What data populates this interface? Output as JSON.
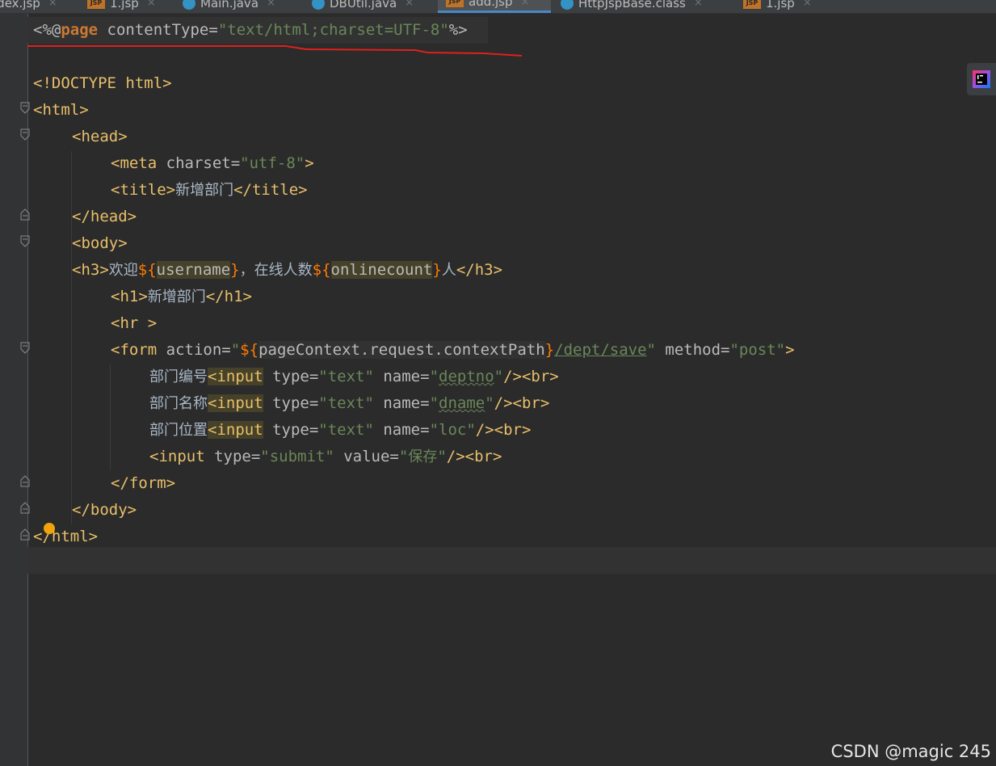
{
  "tabs": [
    {
      "label": "idex.jsp",
      "type": "jsp"
    },
    {
      "label": "1.jsp",
      "type": "jsp"
    },
    {
      "label": "Main.java",
      "type": "java"
    },
    {
      "label": "DBUtil.java",
      "type": "java"
    },
    {
      "label": "add.jsp",
      "type": "jsp",
      "active": true
    },
    {
      "label": "HttpJspBase.class",
      "type": "class"
    },
    {
      "label": "1.jsp",
      "type": "jsp"
    }
  ],
  "file_icon_text": "JSP",
  "close_glyph": "×",
  "badge_icon": "intellij-icon",
  "watermark": "CSDN @magic 245",
  "code": {
    "l1": {
      "open": "<%@",
      "kw": "page",
      "attr": " contentType=",
      "val": "\"text/html;charset=UTF-8\"",
      "close": "%>"
    },
    "l3": "<!DOCTYPE html>",
    "l4": "<html>",
    "l5": "<head>",
    "l6": {
      "tag_open": "<meta",
      "attr": " charset=",
      "val": "\"utf-8\"",
      "tag_close": ">"
    },
    "l7": {
      "open": "<title>",
      "text": "新增部门",
      "close": "</title>"
    },
    "l8": "</head>",
    "l9": "<body>",
    "l10": {
      "open": "<h3>",
      "t1": "欢迎",
      "el1_open": "${",
      "el1": "username",
      "el1_close": "}",
      "t2": "，在线人数",
      "el2_open": "${",
      "el2": "onlinecount",
      "el2_close": "}",
      "t3": "人",
      "close": "</h3>"
    },
    "l11": {
      "open": "<h1>",
      "text": "新增部门",
      "close": "</h1>"
    },
    "l12": "<hr >",
    "l13": {
      "tag_open": "<form",
      "attr1": " action=",
      "q1": "\"",
      "el_open": "${",
      "el": "pageContext.request.contextPath",
      "el_close": "}",
      "path": "/dept/save",
      "q2": "\"",
      "attr2": " method=",
      "val2": "\"post\"",
      "tag_close": ">"
    },
    "l14": {
      "label": "部门编号",
      "tag": "<input",
      "attr1": " type=",
      "val1": "\"text\"",
      "attr2": " name=",
      "q": "\"",
      "name": "deptno",
      "end": "/><br>"
    },
    "l15": {
      "label": "部门名称",
      "tag": "<input",
      "attr1": " type=",
      "val1": "\"text\"",
      "attr2": " name=",
      "q": "\"",
      "name": "dname",
      "end": "/><br>"
    },
    "l16": {
      "label": "部门位置",
      "tag": "<input",
      "attr1": " type=",
      "val1": "\"text\"",
      "attr2": " name=",
      "val2": "\"loc\"",
      "end": "/><br>"
    },
    "l17": {
      "tag": "<input",
      "attr1": " type=",
      "val1": "\"submit\"",
      "attr2": " value=",
      "val2_q1": "\"",
      "val2": "保存",
      "val2_q2": "\"",
      "end": "/><br>"
    },
    "l18": "</form>",
    "l19": "</body>",
    "l20": "</html>"
  }
}
